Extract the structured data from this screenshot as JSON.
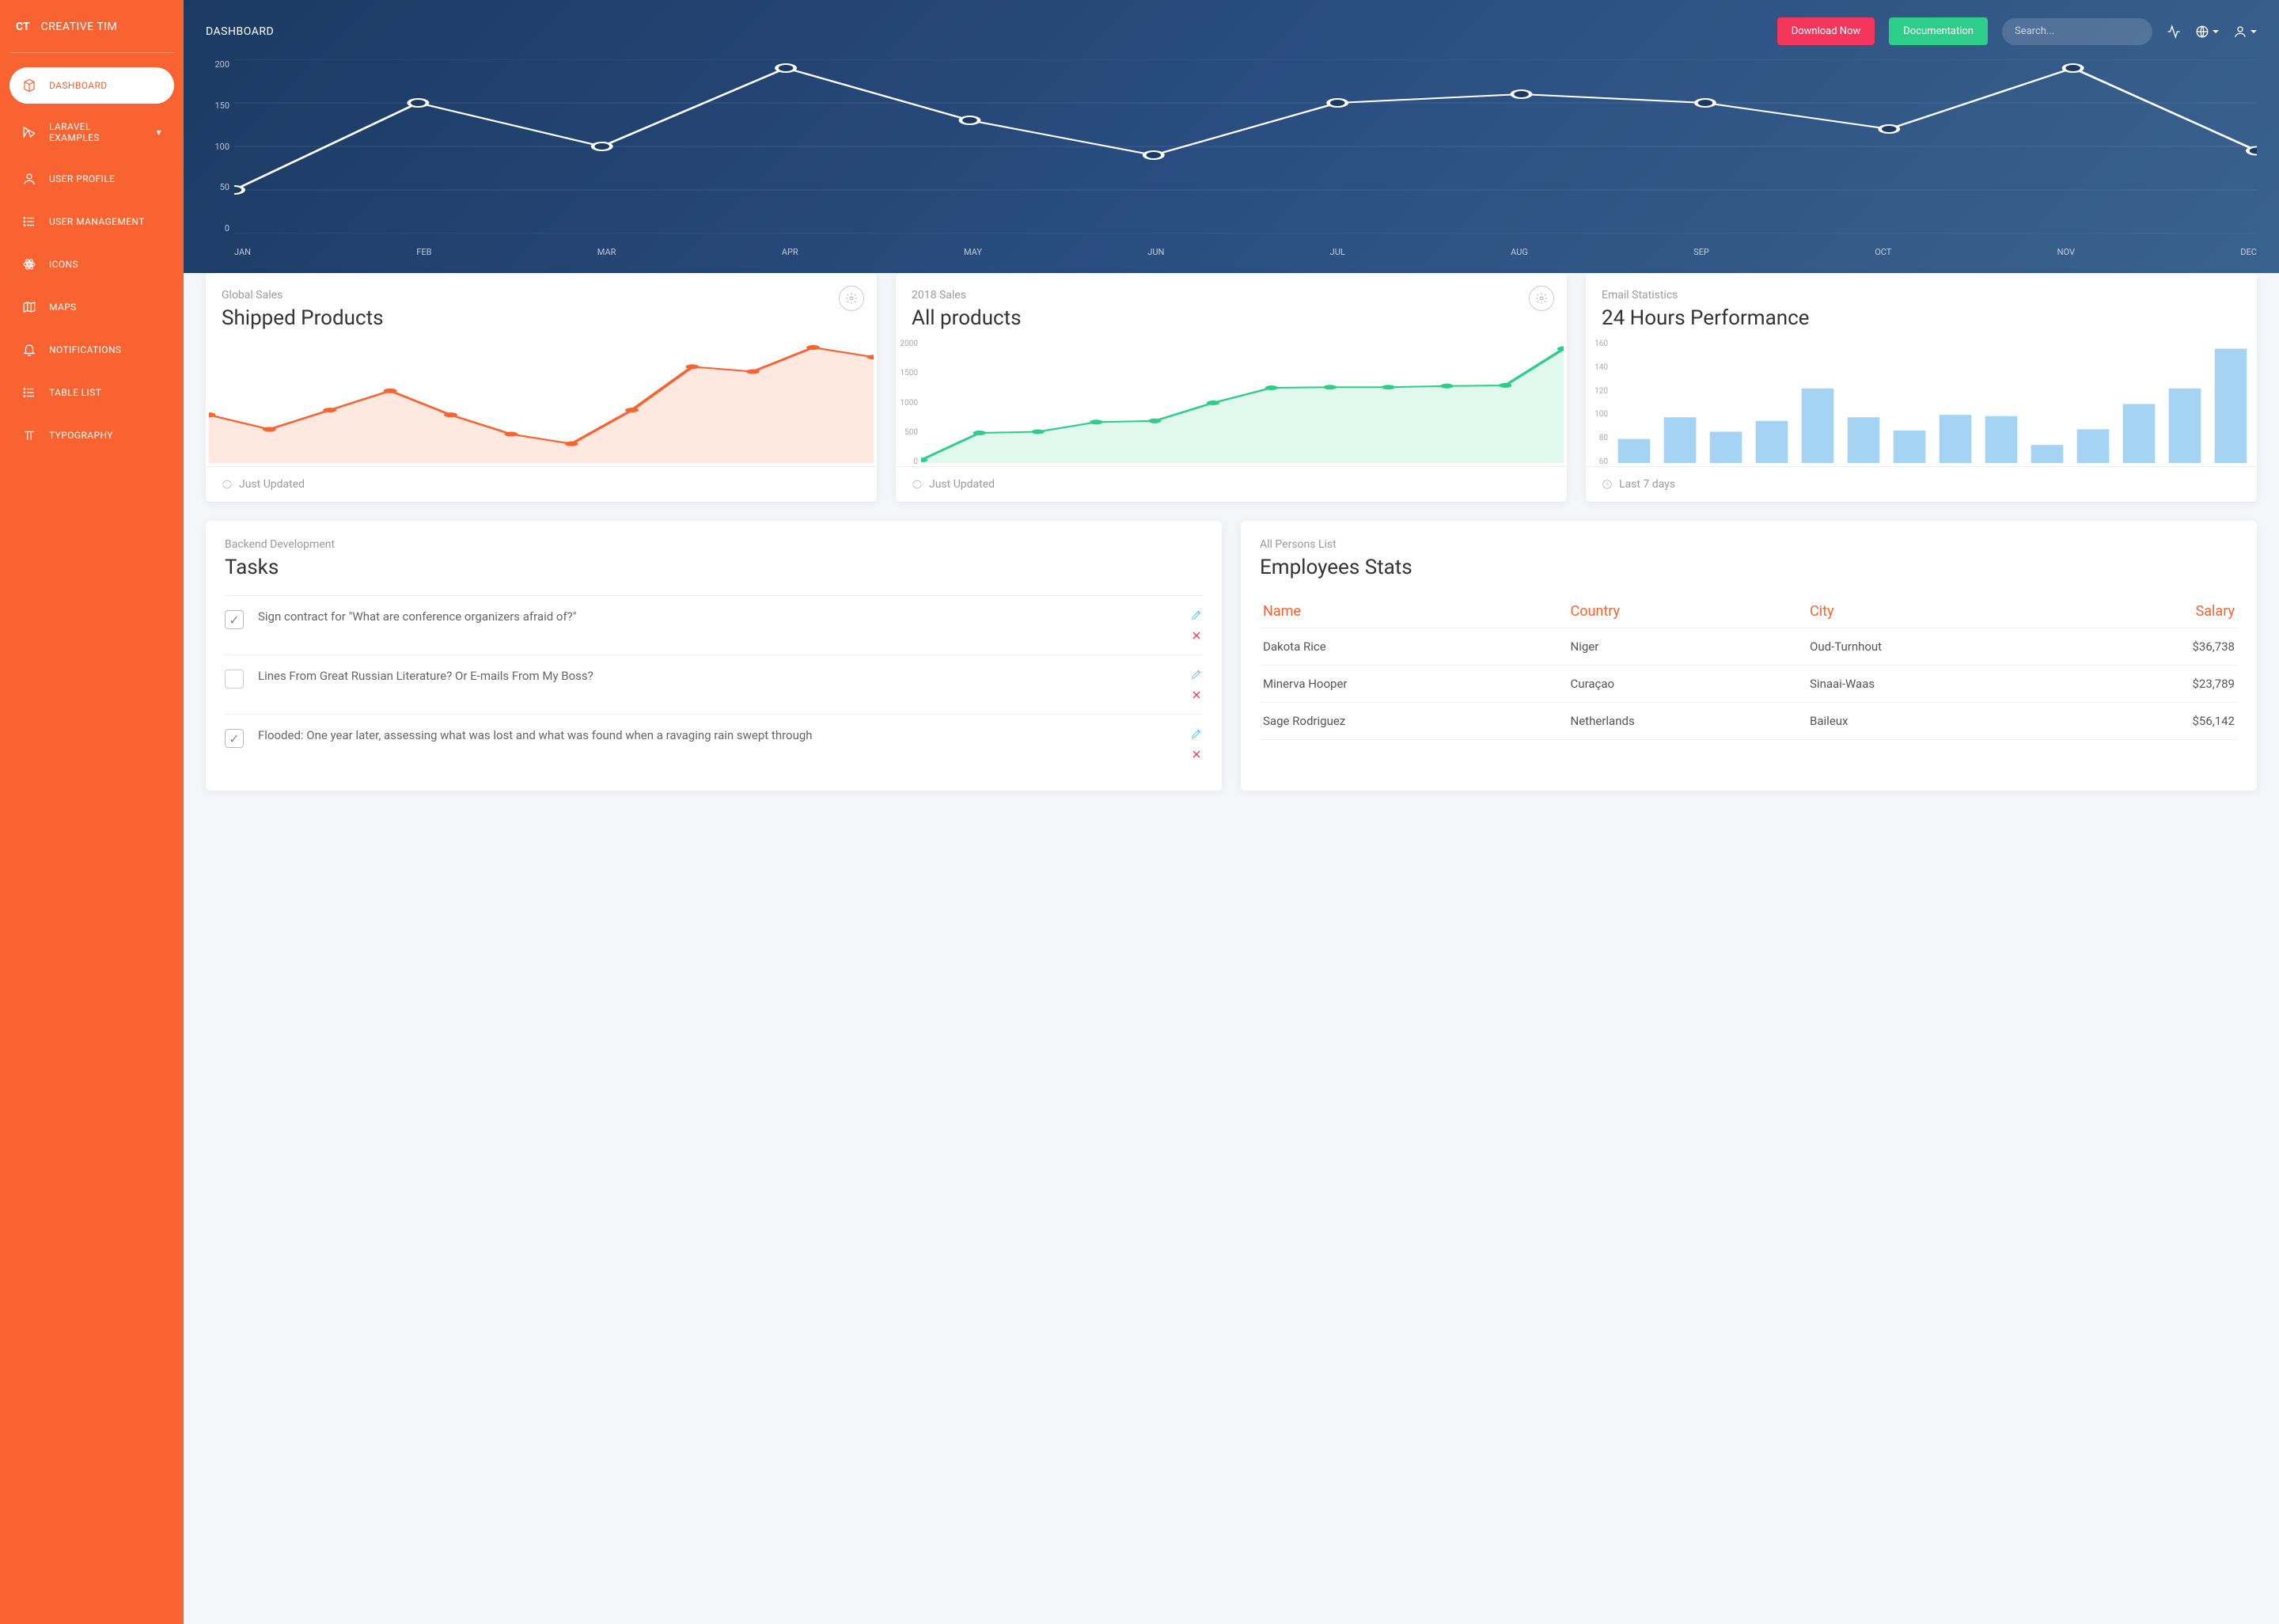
{
  "brand": {
    "badge": "CT",
    "name": "CREATIVE TIM"
  },
  "sidebar": [
    {
      "label": "DASHBOARD",
      "icon": "cube",
      "active": true
    },
    {
      "label": "LARAVEL EXAMPLES",
      "icon": "laravel",
      "caret": true
    },
    {
      "label": "USER PROFILE",
      "icon": "user"
    },
    {
      "label": "USER MANAGEMENT",
      "icon": "list"
    },
    {
      "label": "ICONS",
      "icon": "atom"
    },
    {
      "label": "MAPS",
      "icon": "map"
    },
    {
      "label": "NOTIFICATIONS",
      "icon": "bell"
    },
    {
      "label": "TABLE LIST",
      "icon": "list"
    },
    {
      "label": "TYPOGRAPHY",
      "icon": "type"
    }
  ],
  "topbar": {
    "title": "DASHBOARD",
    "download": "Download Now",
    "docs": "Documentation",
    "search_placeholder": "Search..."
  },
  "chart_data": [
    {
      "id": "main",
      "type": "line",
      "categories": [
        "JAN",
        "FEB",
        "MAR",
        "APR",
        "MAY",
        "JUN",
        "JUL",
        "AUG",
        "SEP",
        "OCT",
        "NOV",
        "DEC"
      ],
      "values": [
        50,
        150,
        100,
        190,
        130,
        90,
        150,
        160,
        150,
        120,
        190,
        95
      ],
      "yticks": [
        0,
        50,
        100,
        150,
        200
      ],
      "ylim": [
        0,
        200
      ]
    },
    {
      "id": "shipped",
      "type": "area",
      "x": [
        1,
        2,
        3,
        4,
        5,
        6,
        7,
        8,
        9,
        10,
        11,
        12
      ],
      "values": [
        300,
        270,
        310,
        350,
        300,
        260,
        240,
        310,
        400,
        390,
        440,
        420
      ],
      "ylim": [
        200,
        450
      ],
      "color": "#f96332"
    },
    {
      "id": "allproducts",
      "type": "area",
      "x": [
        1,
        2,
        3,
        4,
        5,
        6,
        7,
        8,
        9,
        10,
        11,
        12
      ],
      "values": [
        50,
        500,
        520,
        680,
        700,
        1000,
        1250,
        1260,
        1260,
        1280,
        1290,
        1900
      ],
      "yticks": [
        0,
        500,
        1000,
        1500,
        2000
      ],
      "ylim": [
        0,
        2000
      ],
      "color": "#2dce89"
    },
    {
      "id": "hours",
      "type": "bar",
      "x": [
        1,
        2,
        3,
        4,
        5,
        6,
        7,
        8,
        9,
        10,
        11,
        12,
        13,
        14
      ],
      "values": [
        80,
        98,
        86,
        95,
        122,
        98,
        87,
        100,
        99,
        75,
        88,
        109,
        122,
        155
      ],
      "yticks": [
        60,
        80,
        100,
        120,
        140,
        160
      ],
      "ylim": [
        60,
        160
      ],
      "color": "#7ec0ee"
    }
  ],
  "cards": [
    {
      "sup": "Global Sales",
      "title": "Shipped Products",
      "foot": "Just Updated",
      "foot_icon": "refresh",
      "gear": true,
      "chart": "shipped"
    },
    {
      "sup": "2018 Sales",
      "title": "All products",
      "foot": "Just Updated",
      "foot_icon": "refresh",
      "gear": true,
      "chart": "allproducts"
    },
    {
      "sup": "Email Statistics",
      "title": "24 Hours Performance",
      "foot": "Last 7 days",
      "foot_icon": "clock",
      "gear": false,
      "chart": "hours"
    }
  ],
  "tasks": {
    "sup": "Backend Development",
    "title": "Tasks",
    "items": [
      {
        "text": "Sign contract for \"What are conference organizers afraid of?\"",
        "checked": true
      },
      {
        "text": "Lines From Great Russian Literature? Or E-mails From My Boss?",
        "checked": false
      },
      {
        "text": "Flooded: One year later, assessing what was lost and what was found when a ravaging rain swept through",
        "checked": true
      }
    ]
  },
  "employees": {
    "sup": "All Persons List",
    "title": "Employees Stats",
    "headers": [
      "Name",
      "Country",
      "City",
      "Salary"
    ],
    "rows": [
      [
        "Dakota Rice",
        "Niger",
        "Oud-Turnhout",
        "$36,738"
      ],
      [
        "Minerva Hooper",
        "Curaçao",
        "Sinaai-Waas",
        "$23,789"
      ],
      [
        "Sage Rodriguez",
        "Netherlands",
        "Baileux",
        "$56,142"
      ]
    ]
  }
}
